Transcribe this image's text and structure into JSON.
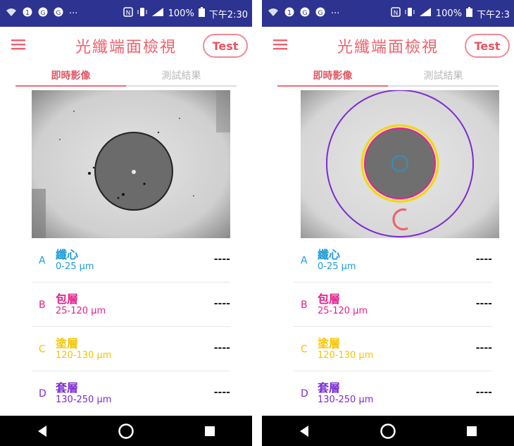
{
  "screens": [
    {
      "status": {
        "dots": "···",
        "battery": "100%",
        "time": "下午2:30"
      },
      "title": "光纖端面檢視",
      "test_label": "Test",
      "tabs": {
        "live": "即時影像",
        "results": "測試結果"
      },
      "image_mode": "raw fiber end-face",
      "layers": [
        {
          "letter": "A",
          "name": "纖心",
          "range": "0-25 µm",
          "value": "----",
          "color": "#1e9bd7"
        },
        {
          "letter": "B",
          "name": "包層",
          "range": "25-120 µm",
          "value": "----",
          "color": "#e91e8c"
        },
        {
          "letter": "C",
          "name": "塗層",
          "range": "120-130 µm",
          "value": "----",
          "color": "#f5c400"
        },
        {
          "letter": "D",
          "name": "套層",
          "range": "130-250 µm",
          "value": "----",
          "color": "#7b2bd3"
        }
      ]
    },
    {
      "status": {
        "dots": "···",
        "battery": "100%",
        "time": "下午2:3"
      },
      "title": "光纖端面檢視",
      "test_label": "Test",
      "tabs": {
        "live": "即時影像",
        "results": "測試結果"
      },
      "image_mode": "end-face with zone overlay",
      "layers": [
        {
          "letter": "A",
          "name": "纖心",
          "range": "0-25 µm",
          "value": "----",
          "color": "#1e9bd7"
        },
        {
          "letter": "B",
          "name": "包層",
          "range": "25-120 µm",
          "value": "----",
          "color": "#e91e8c"
        },
        {
          "letter": "C",
          "name": "塗層",
          "range": "120-130 µm",
          "value": "----",
          "color": "#f5c400"
        },
        {
          "letter": "D",
          "name": "套層",
          "range": "130-250 µm",
          "value": "----",
          "color": "#7b2bd3"
        }
      ]
    }
  ],
  "colors": {
    "status_bar": "#2d3390",
    "accent": "#f0606d"
  },
  "icons": [
    "wifi-icon",
    "sim-icon",
    "nfc-icon",
    "vibrate-icon",
    "signal-icon",
    "battery-icon",
    "menu-icon",
    "back-icon",
    "home-icon",
    "recents-icon"
  ]
}
